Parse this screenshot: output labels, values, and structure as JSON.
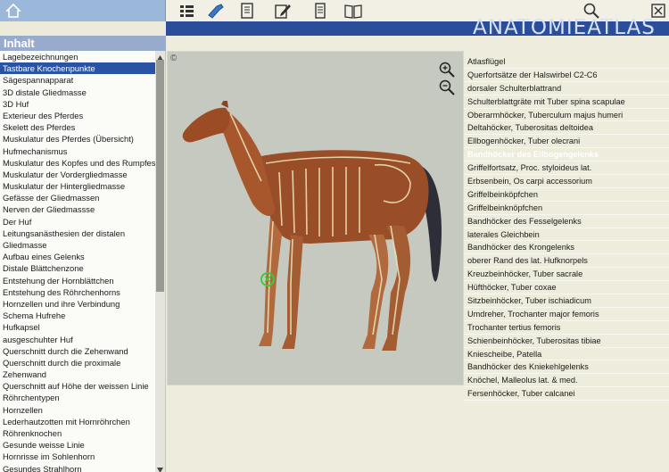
{
  "brand": "ANATOMIEATLAS",
  "sidebar": {
    "title": "Inhalt",
    "selected_index": 1,
    "items": [
      "Lagebezeichnungen",
      "Tastbare Knochenpunkte",
      "Sägespannapparat",
      "3D distale Gliedmasse",
      "3D Huf",
      "Exterieur des Pferdes",
      "Skelett des Pferdes",
      "Muskulatur des Pferdes (Übersicht)",
      "Hufmechanismus",
      "Muskulatur des Kopfes und des Rumpfes",
      "Muskulatur der Vordergliedmasse",
      "Muskulatur der Hintergliedmasse",
      "Gefässe der Gliedmassen",
      "Nerven der Gliedmassse",
      "Der Huf",
      "Leitungsanästhesien der distalen",
      "Gliedmasse",
      "Aufbau eines Gelenks",
      "Distale Blättchenzone",
      "Entstehung der Hornblättchen",
      "Entstehung des Röhrchenhorns",
      "Hornzellen und ihre Verbindung",
      "Schema Hufrehe",
      "Hufkapsel",
      "ausgeschuhter Huf",
      "Querschnitt durch die Zehenwand",
      "Querschnitt durch die proximale",
      "Zehenwand",
      "Querschnitt auf Höhe der weissen Linie",
      "Röhrchentypen",
      "Hornzellen",
      "Lederhautzotten mit Hornröhrchen",
      "Röhrenknochen",
      "Gesunde weisse Linie",
      "Hornrisse im Sohlenhorn",
      "Gesundes Strahlhorn"
    ]
  },
  "image": {
    "copyright": "©"
  },
  "labels": {
    "active_index": 8,
    "items": [
      "Atlasflügel",
      "Querfortsätze der Halswirbel C2-C6",
      "dorsaler Schulterblattrand",
      "Schulterblattgräte mit Tuber spina scapulae",
      "Oberarmhöcker, Tuberculum majus humeri",
      "Deltahöcker, Tuberositas deltoidea",
      "Ellbogenhöcker, Tuber olecrani",
      "Ellbogenhöcker, Tuber olecrani",
      "Bandhöcker des Ellbogengelenks",
      "Griffelfortsatz, Proc. styloideus lat.",
      "Erbsenbein, Os carpi accessorium",
      "Griffelbeinköpfchen",
      "Griffelbeinknöpfchen",
      "Bandhöcker des Fesselgelenks",
      "laterales Gleichbein",
      "Bandhöcker des Krongelenks",
      "oberer Rand des lat. Hufknorpels",
      "Kreuzbeinhöcker, Tuber sacrale",
      "Hüfthöcker, Tuber coxae",
      "Sitzbeinhöcker, Tuber ischiadicum",
      "Umdreher, Trochanter major femoris",
      "Trochanter tertius femoris",
      "Schienbeinhöcker, Tuberositas tibiae",
      "Kniescheibe, Patella",
      "Bandhöcker des Kniekehlgelenks",
      "Knöchel, Malleolus lat. & med.",
      "Fersenhöcker, Tuber calcanei"
    ]
  }
}
